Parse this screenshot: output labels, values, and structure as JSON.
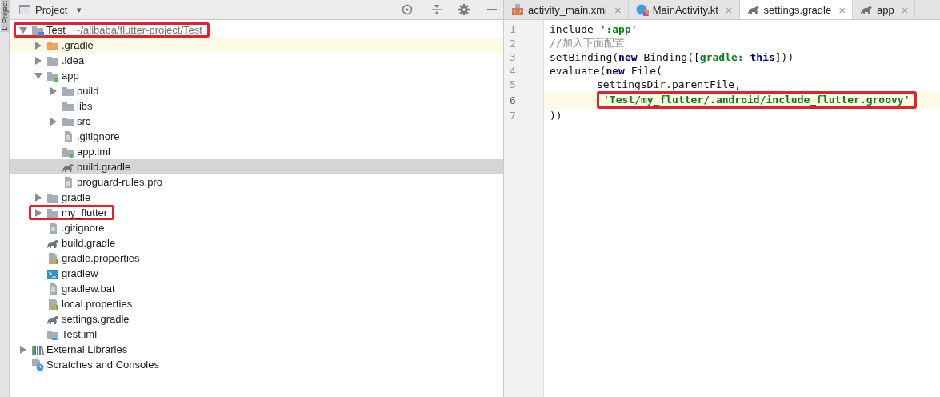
{
  "side_tab": {
    "label": "1: Project"
  },
  "project_panel": {
    "title": "Project",
    "caret": "▾"
  },
  "tree": [
    {
      "name": "Test",
      "hint": "~/alibaba/flutter-project/Test",
      "kind": "module",
      "expanded": true,
      "selected": false,
      "ignored": false,
      "highlighted": true,
      "children": [
        {
          "name": ".gradle",
          "kind": "excluded",
          "expanded": false,
          "selected": false,
          "ignored": true,
          "highlighted": false
        },
        {
          "name": ".idea",
          "kind": "folder",
          "expanded": false,
          "selected": false,
          "ignored": false,
          "highlighted": false
        },
        {
          "name": "app",
          "kind": "android",
          "expanded": true,
          "selected": false,
          "ignored": false,
          "highlighted": false,
          "children": [
            {
              "name": "build",
              "kind": "folder",
              "expanded": false,
              "selected": false,
              "ignored": false,
              "highlighted": false
            },
            {
              "name": "libs",
              "kind": "folder",
              "selected": false,
              "ignored": false,
              "highlighted": false
            },
            {
              "name": "src",
              "kind": "folder",
              "expanded": false,
              "selected": false,
              "ignored": false,
              "highlighted": false
            },
            {
              "name": ".gitignore",
              "kind": "text",
              "selected": false,
              "ignored": false,
              "highlighted": false
            },
            {
              "name": "app.iml",
              "kind": "android",
              "selected": false,
              "ignored": false,
              "highlighted": false
            },
            {
              "name": "build.gradle",
              "kind": "gradle",
              "selected": true,
              "ignored": false,
              "highlighted": false
            },
            {
              "name": "proguard-rules.pro",
              "kind": "text",
              "selected": false,
              "ignored": false,
              "highlighted": false
            }
          ]
        },
        {
          "name": "gradle",
          "kind": "folder",
          "expanded": false,
          "selected": false,
          "ignored": false,
          "highlighted": false
        },
        {
          "name": "my_flutter",
          "kind": "folder",
          "expanded": false,
          "selected": false,
          "ignored": false,
          "highlighted": true
        },
        {
          "name": ".gitignore",
          "kind": "text",
          "selected": false,
          "ignored": false,
          "highlighted": false
        },
        {
          "name": "build.gradle",
          "kind": "gradle",
          "selected": false,
          "ignored": false,
          "highlighted": false
        },
        {
          "name": "gradle.properties",
          "kind": "properties",
          "selected": false,
          "ignored": false,
          "highlighted": false
        },
        {
          "name": "gradlew",
          "kind": "shell",
          "selected": false,
          "ignored": false,
          "highlighted": false
        },
        {
          "name": "gradlew.bat",
          "kind": "text",
          "selected": false,
          "ignored": false,
          "highlighted": false
        },
        {
          "name": "local.properties",
          "kind": "properties",
          "selected": false,
          "ignored": false,
          "highlighted": false
        },
        {
          "name": "settings.gradle",
          "kind": "gradle",
          "selected": false,
          "ignored": false,
          "highlighted": false
        },
        {
          "name": "Test.iml",
          "kind": "iml",
          "selected": false,
          "ignored": false,
          "highlighted": false
        }
      ]
    },
    {
      "name": "External Libraries",
      "kind": "libraries",
      "expanded": false,
      "selected": false,
      "ignored": false,
      "highlighted": false
    },
    {
      "name": "Scratches and Consoles",
      "kind": "scratches",
      "selected": false,
      "ignored": false,
      "highlighted": false
    }
  ],
  "editor_tabs": [
    {
      "label": "activity_main.xml",
      "kind": "xml",
      "selected": false,
      "close": "×"
    },
    {
      "label": "MainActivity.kt",
      "kind": "kotlin",
      "selected": false,
      "close": "×"
    },
    {
      "label": "settings.gradle",
      "kind": "gradle",
      "selected": true,
      "close": "×"
    },
    {
      "label": "app",
      "kind": "gradle",
      "selected": false,
      "close": "×"
    }
  ],
  "code_lines": [
    {
      "number": "1",
      "current": false,
      "indented": false,
      "tokens": [
        {
          "text": "include ",
          "kind": "plain",
          "highlighted": false
        },
        {
          "text": "':app'",
          "kind": "string",
          "highlighted": false
        }
      ]
    },
    {
      "number": "2",
      "current": false,
      "indented": false,
      "tokens": [
        {
          "text": "//加入下面配置",
          "kind": "comment",
          "highlighted": false
        }
      ]
    },
    {
      "number": "3",
      "current": false,
      "indented": false,
      "tokens": [
        {
          "text": "setBinding(",
          "kind": "plain",
          "highlighted": false
        },
        {
          "text": "new",
          "kind": "keyword",
          "highlighted": false
        },
        {
          "text": " Binding([",
          "kind": "plain",
          "highlighted": false
        },
        {
          "text": "gradle: ",
          "kind": "named-arg",
          "highlighted": false
        },
        {
          "text": "this",
          "kind": "keyword",
          "highlighted": false
        },
        {
          "text": "]))",
          "kind": "plain",
          "highlighted": false
        }
      ]
    },
    {
      "number": "4",
      "current": false,
      "indented": false,
      "tokens": [
        {
          "text": "evaluate(",
          "kind": "plain",
          "highlighted": false
        },
        {
          "text": "new",
          "kind": "keyword",
          "highlighted": false
        },
        {
          "text": " File(",
          "kind": "plain",
          "highlighted": false
        }
      ]
    },
    {
      "number": "5",
      "current": false,
      "indented": true,
      "tokens": [
        {
          "text": "settingsDir.parentFile,",
          "kind": "plain",
          "highlighted": false
        }
      ]
    },
    {
      "number": "6",
      "current": true,
      "indented": true,
      "tokens": [
        {
          "text": "'Test/my_flutter/.android/include_flutter.groovy'",
          "kind": "string",
          "highlighted": true
        }
      ]
    },
    {
      "number": "7",
      "current": false,
      "indented": false,
      "tokens": [
        {
          "text": "))",
          "kind": "plain",
          "highlighted": false
        }
      ]
    }
  ]
}
